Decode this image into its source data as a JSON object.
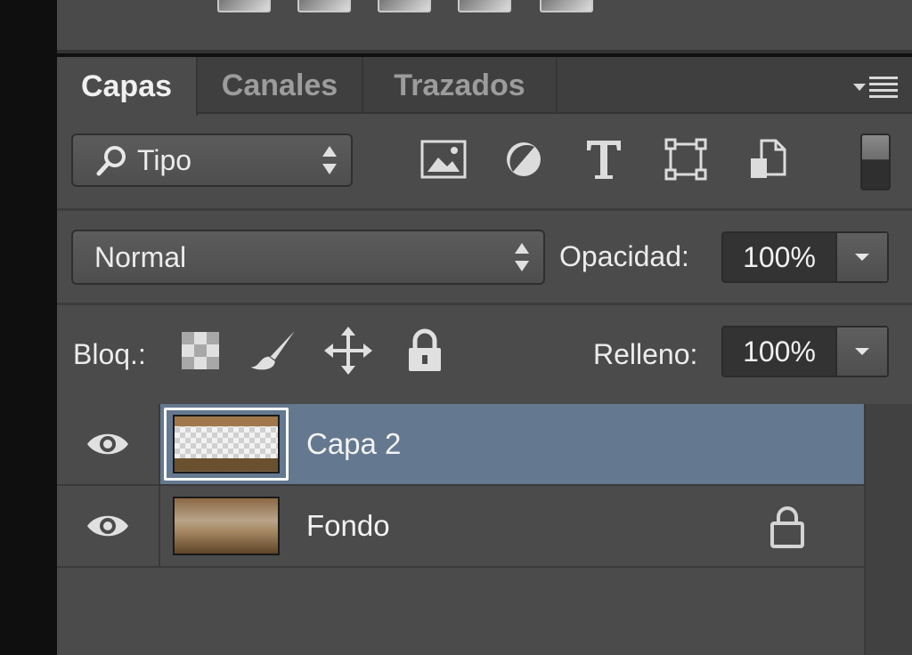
{
  "colors": {
    "panel_bg": "#4b4b4b",
    "tab_bar_bg": "#3f3f3f",
    "selected_row": "#64788f",
    "text": "#ececec"
  },
  "adjustments": {
    "icons": [
      "adjustment-icon-1",
      "adjustment-icon-2",
      "adjustment-icon-3",
      "adjustment-icon-4",
      "adjustment-icon-5"
    ]
  },
  "tabs": [
    {
      "label": "Capas",
      "active": true
    },
    {
      "label": "Canales",
      "active": false
    },
    {
      "label": "Trazados",
      "active": false
    }
  ],
  "panel_menu_icon": "panel-menu-icon",
  "filter": {
    "kind_label": "Tipo",
    "icons": [
      "image-filter-icon",
      "adjustment-filter-icon",
      "type-filter-icon",
      "shape-filter-icon",
      "smart-object-filter-icon",
      "filter-toggle-icon"
    ]
  },
  "blend": {
    "mode": "Normal",
    "opacity_label": "Opacidad:",
    "opacity_value": "100%"
  },
  "lock": {
    "label": "Bloq.:",
    "icons": [
      "lock-transparent-pixels-icon",
      "lock-image-pixels-icon",
      "lock-position-icon",
      "lock-all-icon"
    ],
    "fill_label": "Relleno:",
    "fill_value": "100%"
  },
  "layers": [
    {
      "name": "Capa 2",
      "visible": true,
      "selected": true,
      "locked": false
    },
    {
      "name": "Fondo",
      "visible": true,
      "selected": false,
      "locked": true
    }
  ]
}
